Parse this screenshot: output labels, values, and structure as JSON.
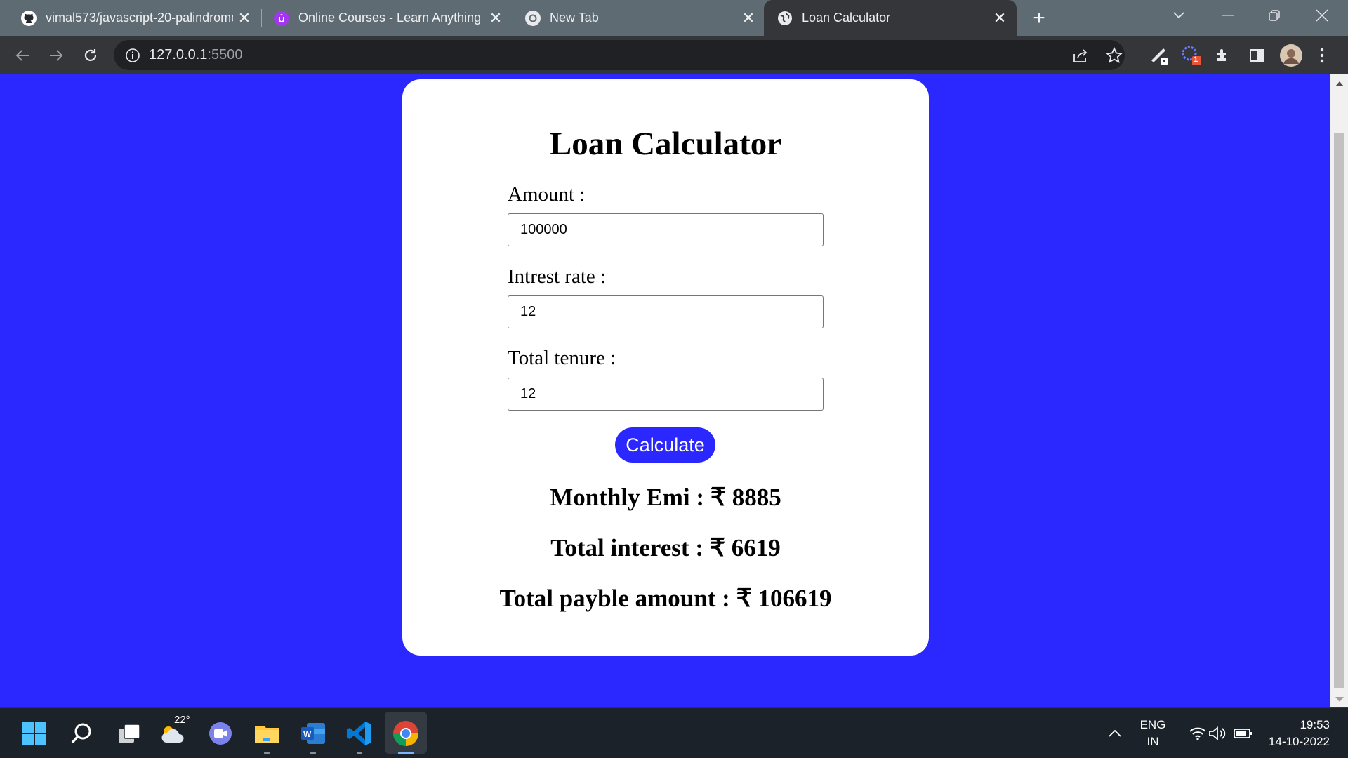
{
  "browser": {
    "tabs": [
      {
        "title": "vimal573/javascript-20-palindrome",
        "icon": "github-icon",
        "active": false
      },
      {
        "title": "Online Courses - Learn Anything",
        "icon": "udemy-icon",
        "active": false
      },
      {
        "title": "New Tab",
        "icon": "chrome-icon",
        "active": false
      },
      {
        "title": "Loan Calculator",
        "icon": "globe-icon",
        "active": true
      }
    ],
    "url_host": "127.0.0.1",
    "url_port": ":5500",
    "extension_badge": "1"
  },
  "page": {
    "title": "Loan Calculator",
    "amount_label": "Amount :",
    "amount_value": "100000",
    "rate_label": "Intrest rate :",
    "rate_value": "12",
    "tenure_label": "Total tenure :",
    "tenure_value": "12",
    "calculate_label": "Calculate",
    "monthly_emi": "Monthly Emi : ₹ 8885",
    "total_interest": "Total interest : ₹ 6619",
    "total_payable": "Total payble amount : ₹ 106619",
    "background_color": "#2b28ff"
  },
  "taskbar": {
    "weather_temp": "22°",
    "lang_primary": "ENG",
    "lang_secondary": "IN",
    "time": "19:53",
    "date": "14-10-2022"
  }
}
